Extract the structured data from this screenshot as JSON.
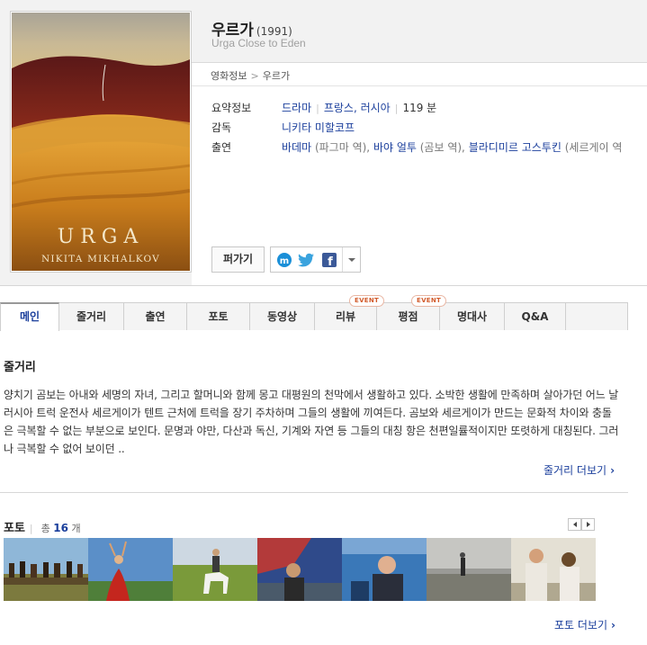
{
  "movie": {
    "title": "우르가",
    "year": "(1991)",
    "english_title": "Urga  Close to Eden",
    "poster_title": "URGA",
    "poster_credit": "NIKITA MIKHALKOV"
  },
  "breadcrumb": [
    "영화정보",
    "우르가"
  ],
  "info": {
    "summary_label": "요약정보",
    "genre": "드라마",
    "countries": "프랑스, 러시아",
    "runtime": "119 분",
    "director_label": "감독",
    "director": "니키타 미할코프",
    "cast_label": "출연",
    "cast": [
      {
        "name": "바데마",
        "role": "(파그마 역),"
      },
      {
        "name": "바야 얼투",
        "role": "(곰보 역),"
      },
      {
        "name": "블라디미르 고스투킨",
        "role": "(세르게이 역"
      }
    ]
  },
  "buttons": {
    "share_label": "퍼가기"
  },
  "sns_icons": [
    "me2day-icon",
    "twitter-icon",
    "facebook-icon"
  ],
  "tabs": [
    {
      "label": "메인",
      "active": true
    },
    {
      "label": "줄거리"
    },
    {
      "label": "출연"
    },
    {
      "label": "포토"
    },
    {
      "label": "동영상"
    },
    {
      "label": "리뷰",
      "badge": "EVENT"
    },
    {
      "label": "평점",
      "badge": "EVENT"
    },
    {
      "label": "명대사"
    },
    {
      "label": "Q&A"
    }
  ],
  "synopsis": {
    "title": "줄거리",
    "text": "양치기 곰보는 아내와 세명의 자녀, 그리고 할머니와 함께 몽고 대평원의 천막에서 생활하고 있다. 소박한 생활에 만족하며 살아가던 어느 날 러시아 트럭 운전사 세르게이가 텐트 근처에 트럭을 장기 주차하며 그들의 생활에 끼여든다. 곰보와 세르게이가 만드는 문화적 차이와 충돌은 극복할 수 없는 부분으로 보인다. 문명과 야만, 다산과 독신, 기계와 자연 등 그들의 대칭 항은 천편일률적이지만 또렷하게 대칭된다. 그러나 극복할 수 없어 보이던 ..",
    "more_label": "줄거리 더보기"
  },
  "photos": {
    "title": "포토",
    "count_prefix": "총",
    "count": "16",
    "count_suffix": "개",
    "more_label": "포토 더보기",
    "thumbnails": [
      "photo-1",
      "photo-2",
      "photo-3",
      "photo-4",
      "photo-5",
      "photo-6",
      "photo-7"
    ]
  },
  "colors": {
    "link": "#1b3f9c",
    "event": "#d25a2a"
  }
}
